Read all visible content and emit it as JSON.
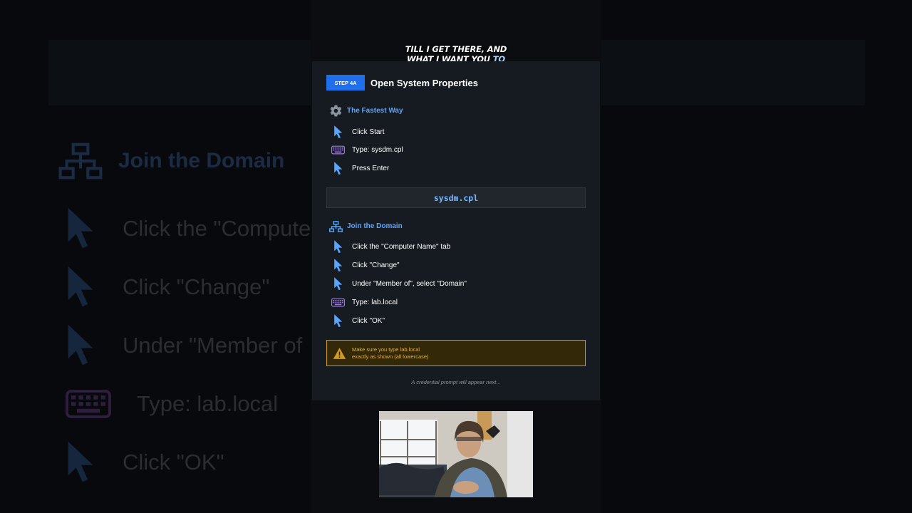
{
  "background": {
    "title": "Join the Domain",
    "rows": [
      {
        "icon": "cursor-icon",
        "text": "Click the \"Compute"
      },
      {
        "icon": "cursor-icon",
        "text": "Click \"Change\""
      },
      {
        "icon": "cursor-icon",
        "text": "Under \"Member of"
      },
      {
        "icon": "keyboard-icon",
        "text": "Type:  lab.local"
      },
      {
        "icon": "cursor-icon",
        "text": "Click \"OK\""
      }
    ]
  },
  "caption": {
    "line1": "TILL I GET THERE, AND",
    "line2_prefix": "WHAT I WANT YOU ",
    "line2_highlight": "TO"
  },
  "card": {
    "step_badge": "STEP 4A",
    "title": "Open System Properties",
    "fastest": {
      "heading": "The Fastest Way",
      "steps": [
        {
          "icon": "cursor-icon",
          "text": "Click Start"
        },
        {
          "icon": "keyboard-icon",
          "text": "Type:  sysdm.cpl"
        },
        {
          "icon": "cursor-icon",
          "text": "Press Enter"
        }
      ]
    },
    "command": "sysdm.cpl",
    "join": {
      "heading": "Join the Domain",
      "steps": [
        {
          "icon": "cursor-icon",
          "text": "Click the \"Computer Name\" tab"
        },
        {
          "icon": "cursor-icon",
          "text": "Click \"Change\""
        },
        {
          "icon": "cursor-icon",
          "text": "Under \"Member of\", select \"Domain\""
        },
        {
          "icon": "keyboard-icon",
          "text": "Type:  lab.local"
        },
        {
          "icon": "cursor-icon",
          "text": "Click \"OK\""
        }
      ]
    },
    "warning": {
      "line1": "Make sure you type lab.local",
      "line2": "exactly as shown (all lowercase)"
    },
    "footer": "A credential prompt will appear next..."
  },
  "colors": {
    "accent": "#1f6feb",
    "link": "#58a6ff",
    "warning": "#d29922",
    "keyboard": "#a371f7"
  }
}
